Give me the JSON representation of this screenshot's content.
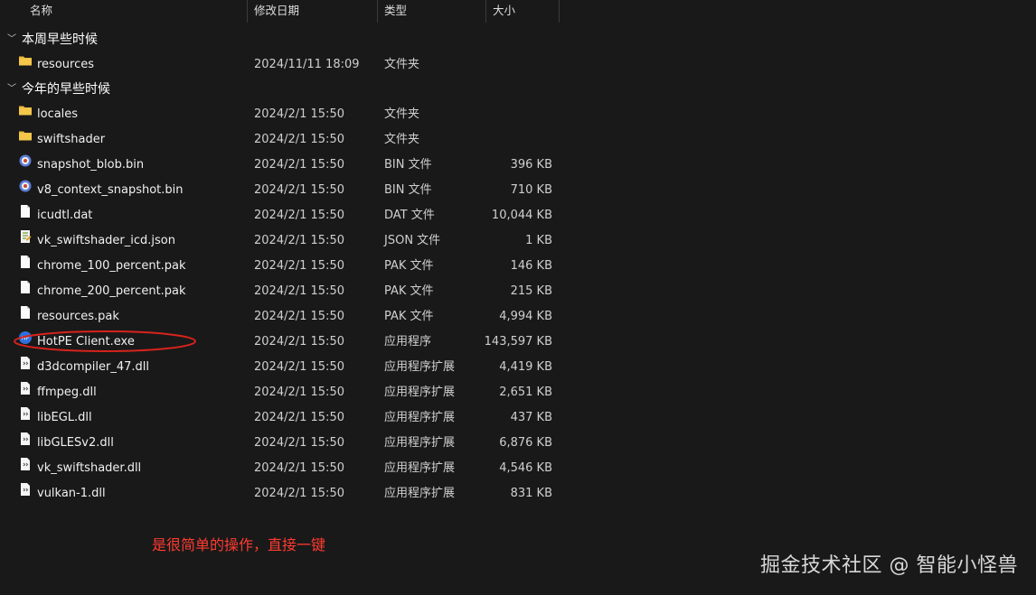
{
  "columns": {
    "name": "名称",
    "date": "修改日期",
    "type": "类型",
    "size": "大小"
  },
  "groups": [
    {
      "label": "本周早些时候"
    },
    {
      "label": "今年的早些时候"
    }
  ],
  "files": [
    {
      "name": "resources",
      "date": "2024/11/11 18:09",
      "type": "文件夹",
      "size": "",
      "icon": "folder-icon"
    },
    {
      "name": "locales",
      "date": "2024/2/1 15:50",
      "type": "文件夹",
      "size": "",
      "icon": "folder-icon"
    },
    {
      "name": "swiftshader",
      "date": "2024/2/1 15:50",
      "type": "文件夹",
      "size": "",
      "icon": "folder-icon"
    },
    {
      "name": "snapshot_blob.bin",
      "date": "2024/2/1 15:50",
      "type": "BIN 文件",
      "size": "396 KB",
      "icon": "bin-file-icon"
    },
    {
      "name": "v8_context_snapshot.bin",
      "date": "2024/2/1 15:50",
      "type": "BIN 文件",
      "size": "710 KB",
      "icon": "bin-file-icon"
    },
    {
      "name": "icudtl.dat",
      "date": "2024/2/1 15:50",
      "type": "DAT 文件",
      "size": "10,044 KB",
      "icon": "file-icon"
    },
    {
      "name": "vk_swiftshader_icd.json",
      "date": "2024/2/1 15:50",
      "type": "JSON 文件",
      "size": "1 KB",
      "icon": "json-file-icon"
    },
    {
      "name": "chrome_100_percent.pak",
      "date": "2024/2/1 15:50",
      "type": "PAK 文件",
      "size": "146 KB",
      "icon": "file-icon"
    },
    {
      "name": "chrome_200_percent.pak",
      "date": "2024/2/1 15:50",
      "type": "PAK 文件",
      "size": "215 KB",
      "icon": "file-icon"
    },
    {
      "name": "resources.pak",
      "date": "2024/2/1 15:50",
      "type": "PAK 文件",
      "size": "4,994 KB",
      "icon": "file-icon"
    },
    {
      "name": "HotPE Client.exe",
      "date": "2024/2/1 15:50",
      "type": "应用程序",
      "size": "143,597 KB",
      "icon": "app-icon"
    },
    {
      "name": "d3dcompiler_47.dll",
      "date": "2024/2/1 15:50",
      "type": "应用程序扩展",
      "size": "4,419 KB",
      "icon": "dll-file-icon"
    },
    {
      "name": "ffmpeg.dll",
      "date": "2024/2/1 15:50",
      "type": "应用程序扩展",
      "size": "2,651 KB",
      "icon": "dll-file-icon"
    },
    {
      "name": "libEGL.dll",
      "date": "2024/2/1 15:50",
      "type": "应用程序扩展",
      "size": "437 KB",
      "icon": "dll-file-icon"
    },
    {
      "name": "libGLESv2.dll",
      "date": "2024/2/1 15:50",
      "type": "应用程序扩展",
      "size": "6,876 KB",
      "icon": "dll-file-icon"
    },
    {
      "name": "vk_swiftshader.dll",
      "date": "2024/2/1 15:50",
      "type": "应用程序扩展",
      "size": "4,546 KB",
      "icon": "dll-file-icon"
    },
    {
      "name": "vulkan-1.dll",
      "date": "2024/2/1 15:50",
      "type": "应用程序扩展",
      "size": "831 KB",
      "icon": "dll-file-icon"
    }
  ],
  "annotation": {
    "note": "是很简单的操作，直接一键",
    "color": "#e0261f"
  },
  "watermark": "掘金技术社区 @ 智能小怪兽",
  "colors": {
    "background": "#191919",
    "folder": "#f4c74a",
    "text": "#f0f0f0"
  }
}
